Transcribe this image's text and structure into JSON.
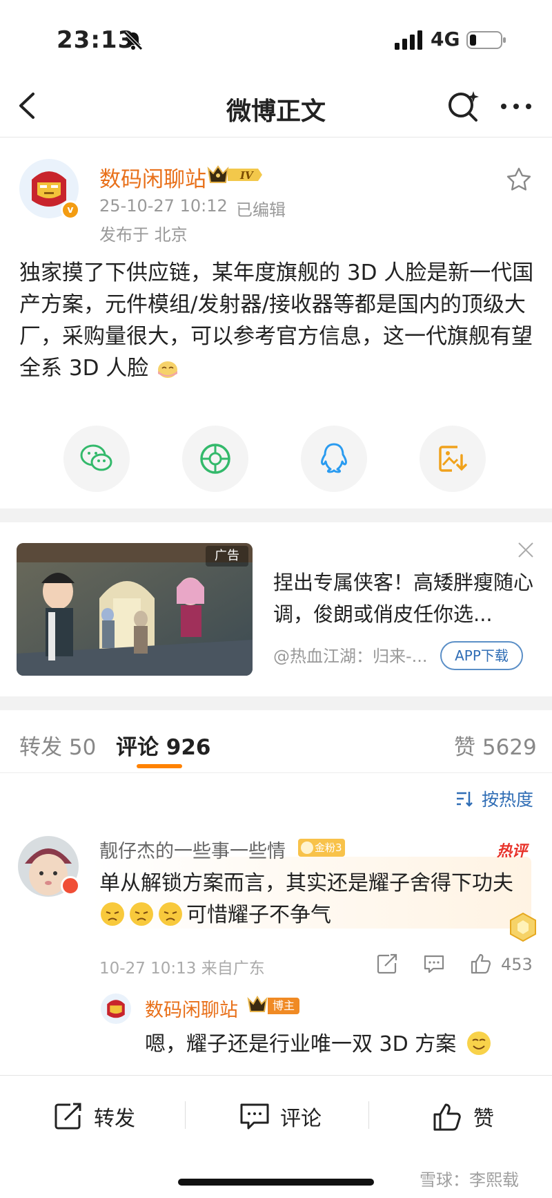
{
  "status_bar": {
    "time": "23:13",
    "network": "4G"
  },
  "nav": {
    "title": "微博正文"
  },
  "post": {
    "author": "数码闲聊站",
    "level": "IV",
    "timestamp": "25-10-27 10:12",
    "edited": "已编辑",
    "location": "发布于 北京",
    "text": "独家摸了下供应链，某年度旗舰的 3D 人脸是新一代国产方案，元件模组/发射器/接收器等都是国内的顶级大厂，采购量很大，可以参考官方信息，这一代旗舰有望全系 3D 人脸"
  },
  "share": [
    "wechat-icon",
    "moments-icon",
    "qq-icon",
    "save-image-icon"
  ],
  "ad": {
    "tag": "广告",
    "title": "捏出专属侠客！高矮胖瘦随心调，俊朗或俏皮任你选...",
    "source": "@热血江湖：归来-...",
    "button": "APP下载"
  },
  "tabs": {
    "repost": "转发 50",
    "comments": "评论 926",
    "likes": "赞 5629"
  },
  "sort": {
    "label": "按热度"
  },
  "comment": {
    "name": "靓仔杰的一些事一些情",
    "fan_badge": "金粉3",
    "hot_tag": "热评",
    "text_line1": "单从解锁方案而言，其实还是耀子舍得下功夫",
    "text_line2": "可惜耀子不争气",
    "time": "10-27 10:13 来自广东",
    "likes": "453"
  },
  "reply": {
    "name": "数码闲聊站",
    "host_badge": "博主",
    "text": "嗯，耀子还是行业唯一双 3D 方案"
  },
  "bottom_bar": {
    "repost": "转发",
    "comment": "评论",
    "like": "赞"
  },
  "watermark": "雪球：李熙载",
  "colors": {
    "accent": "#ff8200",
    "author": "#e8701a",
    "link": "#2f6db5"
  }
}
